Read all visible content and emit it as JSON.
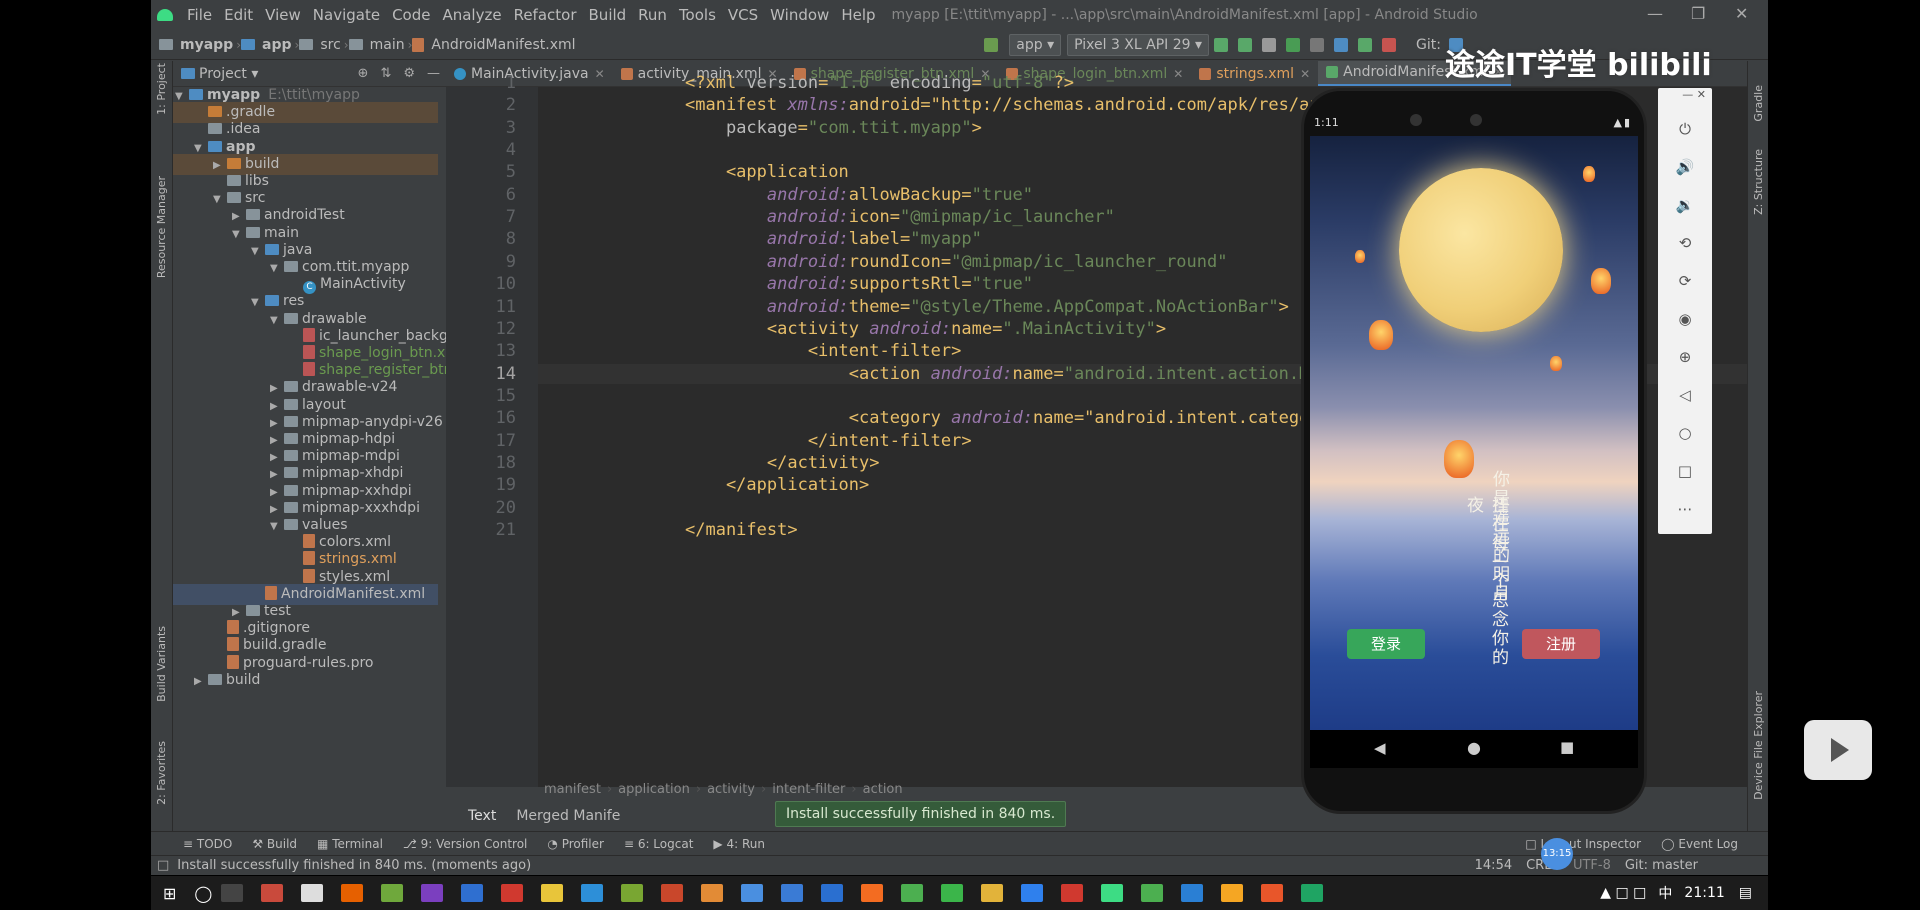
{
  "window": {
    "menu": [
      "File",
      "Edit",
      "View",
      "Navigate",
      "Code",
      "Analyze",
      "Refactor",
      "Build",
      "Run",
      "Tools",
      "VCS",
      "Window",
      "Help"
    ],
    "title": "myapp [E:\\ttit\\myapp] - ...\\app\\src\\main\\AndroidManifest.xml [app] - Android Studio"
  },
  "navbar": {
    "crumbs": [
      "myapp",
      "app",
      "src",
      "main",
      "AndroidManifest.xml"
    ],
    "run_config": "app",
    "device": "Pixel 3 XL API 29",
    "git_label": "Git:"
  },
  "project_panel": {
    "title": "Project",
    "tree": [
      {
        "label": "myapp",
        "extra": "E:\\ttit\\myapp",
        "indent": 0
      },
      {
        "label": ".gradle",
        "indent": 1
      },
      {
        "label": ".idea",
        "indent": 1
      },
      {
        "label": "app",
        "indent": 1
      },
      {
        "label": "build",
        "indent": 2
      },
      {
        "label": "libs",
        "indent": 2
      },
      {
        "label": "src",
        "indent": 2
      },
      {
        "label": "androidTest",
        "indent": 3
      },
      {
        "label": "main",
        "indent": 3
      },
      {
        "label": "java",
        "indent": 4
      },
      {
        "label": "com.ttit.myapp",
        "indent": 5
      },
      {
        "label": "MainActivity",
        "indent": 6
      },
      {
        "label": "res",
        "indent": 4
      },
      {
        "label": "drawable",
        "indent": 5
      },
      {
        "label": "ic_launcher_background.x",
        "indent": 6
      },
      {
        "label": "shape_login_btn.xml",
        "indent": 6
      },
      {
        "label": "shape_register_btn.xml",
        "indent": 6
      },
      {
        "label": "drawable-v24",
        "indent": 5
      },
      {
        "label": "layout",
        "indent": 5
      },
      {
        "label": "mipmap-anydpi-v26",
        "indent": 5
      },
      {
        "label": "mipmap-hdpi",
        "indent": 5
      },
      {
        "label": "mipmap-mdpi",
        "indent": 5
      },
      {
        "label": "mipmap-xhdpi",
        "indent": 5
      },
      {
        "label": "mipmap-xxhdpi",
        "indent": 5
      },
      {
        "label": "mipmap-xxxhdpi",
        "indent": 5
      },
      {
        "label": "values",
        "indent": 5
      },
      {
        "label": "colors.xml",
        "indent": 6
      },
      {
        "label": "strings.xml",
        "indent": 6
      },
      {
        "label": "styles.xml",
        "indent": 6
      },
      {
        "label": "AndroidManifest.xml",
        "indent": 4
      },
      {
        "label": "test",
        "indent": 3
      },
      {
        "label": ".gitignore",
        "indent": 2
      },
      {
        "label": "build.gradle",
        "indent": 2
      },
      {
        "label": "proguard-rules.pro",
        "indent": 2
      },
      {
        "label": "build",
        "indent": 1
      }
    ]
  },
  "side_labels": {
    "project": "1: Project",
    "resource_manager": "Resource Manager",
    "build_variants": "Build Variants",
    "favorites": "2: Favorites",
    "gradle": "Gradle",
    "structure": "Z: Structure",
    "device_file_explorer": "Device File Explorer"
  },
  "editor_tabs": [
    {
      "label": "MainActivity.java",
      "active": false
    },
    {
      "label": "activity_main.xml",
      "active": false
    },
    {
      "label": "shape_register_btn.xml",
      "active": false
    },
    {
      "label": "shape_login_btn.xml",
      "active": false
    },
    {
      "label": "strings.xml",
      "active": false
    },
    {
      "label": "AndroidManifest.xml",
      "active": true
    }
  ],
  "code": {
    "line_numbers": [
      "1",
      "2",
      "3",
      "4",
      "5",
      "6",
      "7",
      "8",
      "9",
      "10",
      "11",
      "12",
      "13",
      "14",
      "15",
      "16",
      "17",
      "18",
      "19",
      "20",
      "21"
    ],
    "lines": [
      "<?xml version=\"1.0\" encoding=\"utf-8\"?>",
      "<manifest xmlns:android=\"http://schemas.android.com/apk/res/andro",
      "    package=\"com.ttit.myapp\">",
      "",
      "    <application",
      "        android:allowBackup=\"true\"",
      "        android:icon=\"@mipmap/ic_launcher\"",
      "        android:label=\"myapp\"",
      "        android:roundIcon=\"@mipmap/ic_launcher_round\"",
      "        android:supportsRtl=\"true\"",
      "        android:theme=\"@style/Theme.AppCompat.NoActionBar\">",
      "        <activity android:name=\".MainActivity\">",
      "            <intent-filter>",
      "                <action android:name=\"android.intent.action.MAIN\"",
      "",
      "                <category android:name=\"android.intent.category.L",
      "            </intent-filter>",
      "        </activity>",
      "    </application>",
      "",
      "</manifest>"
    ],
    "current_line_index": 13
  },
  "breadcrumb_bottom": [
    "manifest",
    "application",
    "activity",
    "intent-filter",
    "action"
  ],
  "bottom_editor_tabs": [
    "Text",
    "Merged Manife"
  ],
  "toast": "Install successfully finished in 840 ms.",
  "tool_windows": [
    "TODO",
    "Build",
    "Terminal",
    "9: Version Control",
    "Profiler",
    "6: Logcat",
    "4: Run"
  ],
  "tool_windows_right": [
    "Layout Inspector",
    "Event Log"
  ],
  "status": {
    "message": "Install successfully finished in 840 ms. (moments ago)",
    "position": "14:54",
    "line_sep": "CRLF",
    "encoding": "UTF-8",
    "git": "Git: master"
  },
  "phone": {
    "time": "1:11",
    "poem_columns": [
      "你是遥远的明月",
      "挂在每一个思念你的夜"
    ],
    "login_label": "登录",
    "register_label": "注册"
  },
  "watermark": "途途IT学堂 bilibili",
  "timer_badge": "13:15",
  "taskbar": {
    "clock": "21:11",
    "ime": "中"
  }
}
